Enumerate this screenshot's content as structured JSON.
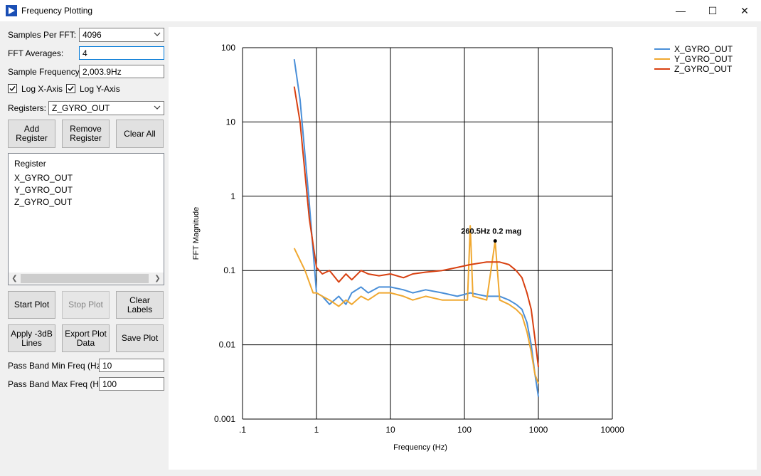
{
  "window": {
    "title": "Frequency Plotting",
    "minimize_glyph": "—",
    "maximize_glyph": "☐",
    "close_glyph": "✕"
  },
  "settings": {
    "samples_per_fft_label": "Samples Per FFT:",
    "samples_per_fft_value": "4096",
    "fft_averages_label": "FFT Averages:",
    "fft_averages_value": "4",
    "sample_frequency_label": "Sample Frequency:",
    "sample_frequency_value": "2,003.9Hz",
    "log_x_label": "Log X-Axis",
    "log_x_checked": true,
    "log_y_label": "Log Y-Axis",
    "log_y_checked": true,
    "registers_label": "Registers:",
    "registers_value": "Z_GYRO_OUT"
  },
  "buttons": {
    "add_register": "Add\nRegister",
    "remove_register": "Remove\nRegister",
    "clear_all": "Clear All",
    "start_plot": "Start Plot",
    "stop_plot": "Stop Plot",
    "clear_labels": "Clear\nLabels",
    "apply_3db": "Apply -3dB\nLines",
    "export_plot_data": "Export Plot\nData",
    "save_plot": "Save Plot"
  },
  "register_list": {
    "header": "Register",
    "items": [
      "X_GYRO_OUT",
      "Y_GYRO_OUT",
      "Z_GYRO_OUT"
    ]
  },
  "pass_band": {
    "min_label": "Pass Band Min Freq (Hz):",
    "min_value": "10",
    "max_label": "Pass Band Max Freq (Hz):",
    "max_value": "100"
  },
  "chart_data": {
    "type": "line",
    "title": "",
    "xlabel": "Frequency (Hz)",
    "ylabel": "FFT Magnitude",
    "x_scale": "log",
    "y_scale": "log",
    "xlim": [
      0.1,
      10000
    ],
    "ylim": [
      0.001,
      100
    ],
    "x_tick_labels": [
      ".1",
      "1",
      "10",
      "100",
      "1000",
      "10000"
    ],
    "y_tick_labels": [
      "0.001",
      "0.01",
      "0.1",
      "1",
      "10",
      "100"
    ],
    "grid": true,
    "legend_position": "top-right",
    "annotation": {
      "text": "260.5Hz 0.2 mag",
      "x": 260.5,
      "y": 0.25
    },
    "series": [
      {
        "name": "X_GYRO_OUT",
        "color": "#4a8fd8",
        "x": [
          0.5,
          0.6,
          0.8,
          1.0,
          1.2,
          1.5,
          2.0,
          2.5,
          3.0,
          4.0,
          5.0,
          7.0,
          10,
          15,
          20,
          30,
          50,
          80,
          120,
          200,
          300,
          400,
          500,
          600,
          700,
          800,
          900,
          1000
        ],
        "y": [
          70,
          20,
          0.8,
          0.05,
          0.045,
          0.035,
          0.045,
          0.035,
          0.05,
          0.06,
          0.05,
          0.06,
          0.06,
          0.055,
          0.05,
          0.055,
          0.05,
          0.045,
          0.05,
          0.045,
          0.045,
          0.04,
          0.035,
          0.03,
          0.02,
          0.01,
          0.004,
          0.002
        ]
      },
      {
        "name": "Y_GYRO_OUT",
        "color": "#f0a830",
        "x": [
          0.5,
          0.7,
          0.9,
          1.0,
          1.2,
          1.5,
          2.0,
          2.5,
          3.0,
          4.0,
          5.0,
          7.0,
          10,
          15,
          20,
          30,
          50,
          80,
          110,
          120,
          130,
          200,
          260.5,
          300,
          400,
          500,
          600,
          700,
          800,
          900,
          1000
        ],
        "y": [
          0.2,
          0.1,
          0.05,
          0.05,
          0.045,
          0.04,
          0.033,
          0.04,
          0.035,
          0.045,
          0.04,
          0.05,
          0.05,
          0.045,
          0.04,
          0.045,
          0.04,
          0.04,
          0.04,
          0.4,
          0.045,
          0.04,
          0.25,
          0.04,
          0.035,
          0.03,
          0.025,
          0.015,
          0.008,
          0.004,
          0.003
        ]
      },
      {
        "name": "Z_GYRO_OUT",
        "color": "#d84010",
        "x": [
          0.5,
          0.6,
          0.8,
          1.0,
          1.2,
          1.5,
          2.0,
          2.5,
          3.0,
          4.0,
          5.0,
          7.0,
          10,
          15,
          20,
          30,
          50,
          80,
          120,
          200,
          300,
          400,
          500,
          600,
          700,
          800,
          900,
          1000
        ],
        "y": [
          30,
          10,
          0.5,
          0.11,
          0.09,
          0.1,
          0.07,
          0.09,
          0.075,
          0.1,
          0.09,
          0.085,
          0.09,
          0.08,
          0.09,
          0.095,
          0.1,
          0.11,
          0.12,
          0.13,
          0.13,
          0.12,
          0.1,
          0.08,
          0.05,
          0.03,
          0.012,
          0.005
        ]
      }
    ]
  }
}
